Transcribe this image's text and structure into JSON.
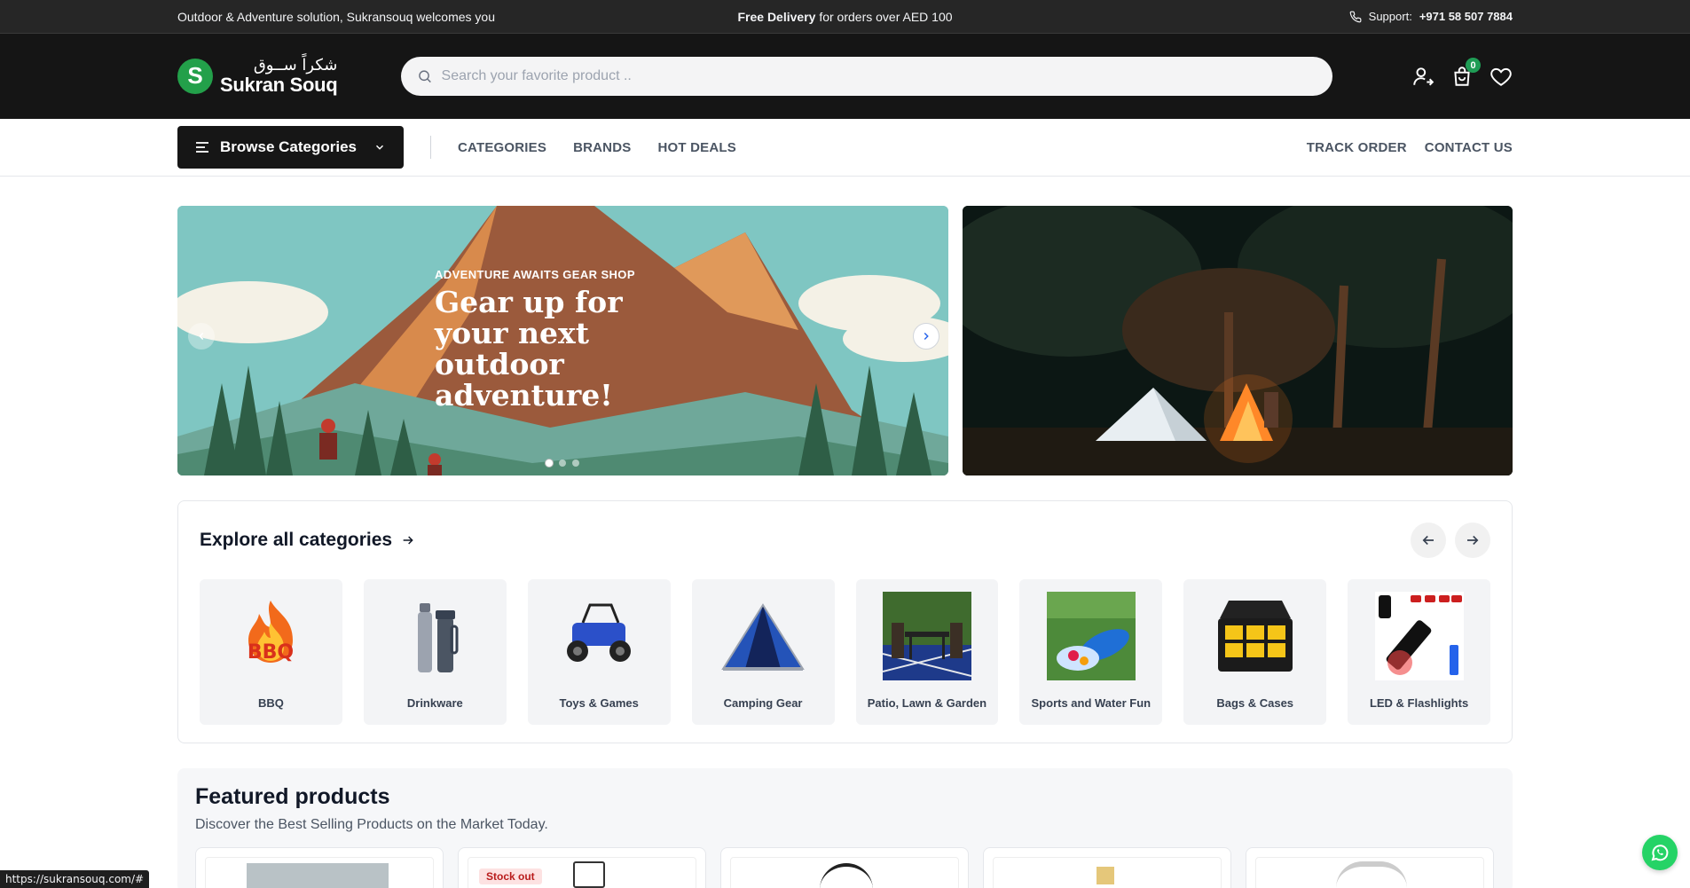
{
  "topbar": {
    "welcome": "Outdoor & Adventure solution, Sukransouq welcomes you",
    "delivery_bold": "Free Delivery",
    "delivery_rest": " for orders over AED 100",
    "support_label": "Support:",
    "support_phone": "+971 58 507 7884"
  },
  "header": {
    "logo_ar": "شكراً ســوق",
    "logo_en": "Sukran Souq",
    "search_placeholder": "Search your favorite product ..",
    "cart_count": "0"
  },
  "nav": {
    "browse_label": "Browse Categories",
    "links": [
      "CATEGORIES",
      "BRANDS",
      "HOT DEALS"
    ],
    "right_links": [
      "TRACK ORDER",
      "CONTACT US"
    ]
  },
  "hero": {
    "kicker": "ADVENTURE AWAITS GEAR SHOP",
    "headline": "Gear up for your next outdoor adventure!",
    "slides": 3,
    "active_slide": 1
  },
  "categories": {
    "title": "Explore all categories",
    "items": [
      {
        "name": "BBQ",
        "icon": "bbq-flame-icon"
      },
      {
        "name": "Drinkware",
        "icon": "thermos-icon"
      },
      {
        "name": "Toys & Games",
        "icon": "toy-car-icon"
      },
      {
        "name": "Camping Gear",
        "icon": "tent-icon"
      },
      {
        "name": "Patio, Lawn & Garden",
        "icon": "patio-furniture-icon"
      },
      {
        "name": "Sports and Water Fun",
        "icon": "water-slide-icon"
      },
      {
        "name": "Bags & Cases",
        "icon": "hard-case-icon"
      },
      {
        "name": "LED & Flashlights",
        "icon": "flashlight-icon"
      }
    ]
  },
  "featured": {
    "title": "Featured products",
    "subtitle": "Discover the Best Selling Products on the Market Today.",
    "stock_badge": "Stock out"
  },
  "status_url": "https://sukransouq.com/#",
  "colors": {
    "brand_green": "#23a04a",
    "header_bg": "#151515",
    "topbar_bg": "#262626"
  }
}
